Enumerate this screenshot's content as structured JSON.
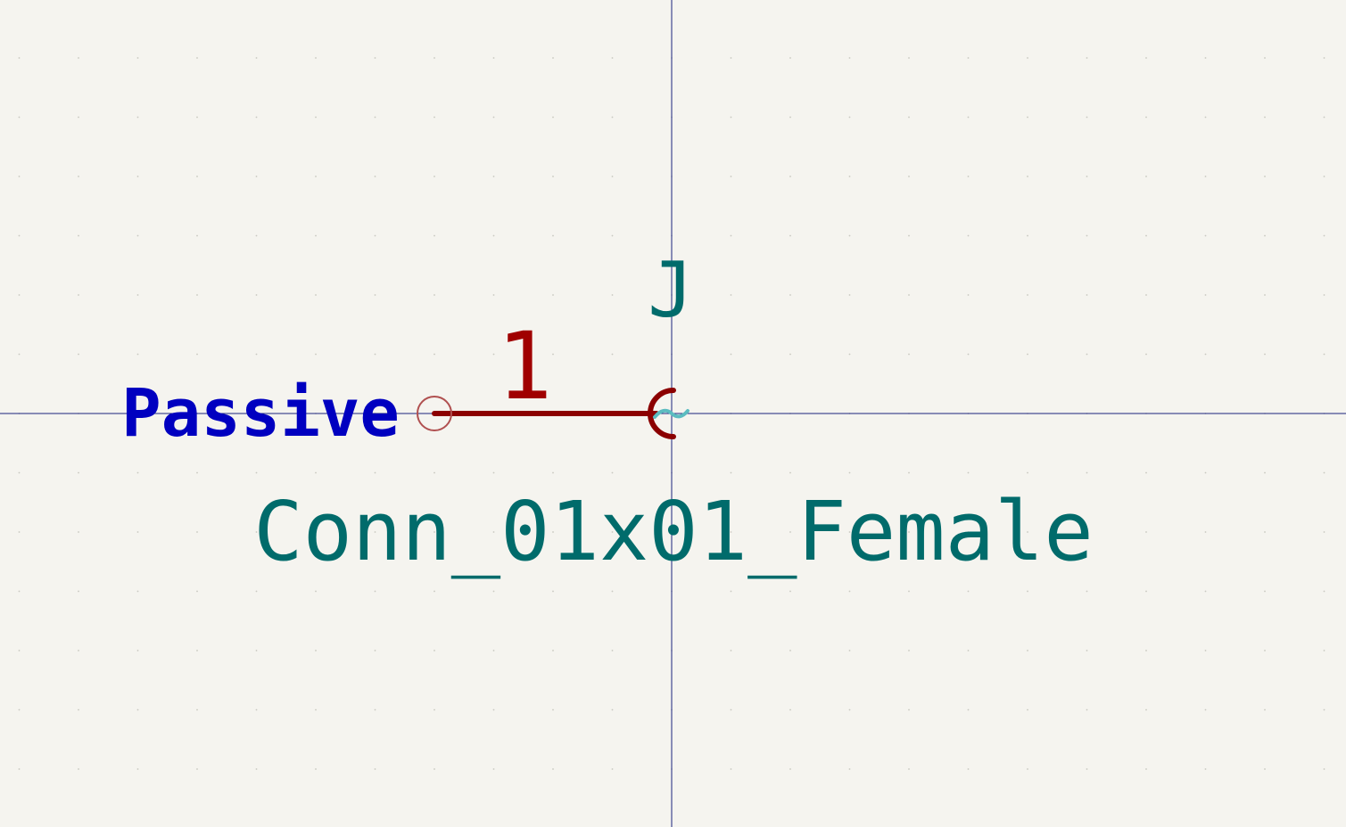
{
  "editor": {
    "background_color": "#f5f4ef",
    "grid_color": "#c8c8c0",
    "axis_color": "#1a237e"
  },
  "symbol": {
    "reference": "J",
    "value": "Conn_01x01_Female",
    "reference_color": "#006b6b",
    "value_color": "#006b6b",
    "body_color": "#8b0000",
    "pin": {
      "number": "1",
      "electrical_type": "Passive",
      "number_color": "#a00000",
      "type_color": "#0000c0",
      "line_color": "#8b0000",
      "endpoint_icon": "pin-endpoint-circle-icon",
      "endpoint_color": "#b05050"
    },
    "unconnected_marker": {
      "glyph": "~",
      "icon": "no-connect-tilde-icon",
      "color": "#5bbcc0"
    },
    "body_icon": "female-socket-arc-icon"
  }
}
